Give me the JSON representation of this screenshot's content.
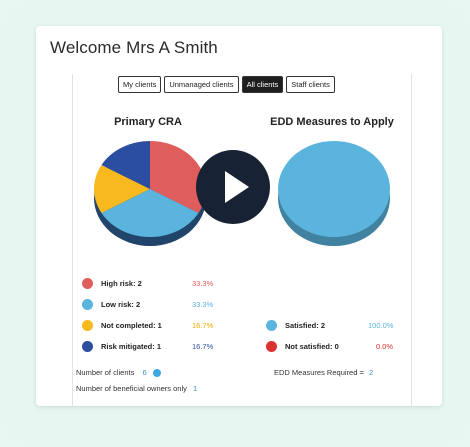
{
  "header": {
    "welcome": "Welcome Mrs A Smith"
  },
  "tabs": [
    {
      "label": "My clients"
    },
    {
      "label": "Unmanaged clients"
    },
    {
      "label": "All clients",
      "active": true
    },
    {
      "label": "Staff clients"
    }
  ],
  "primary_cra": {
    "title": "Primary CRA",
    "legend": [
      {
        "label": "High risk: 2",
        "pct": "33.3%",
        "color": "#e05d5d"
      },
      {
        "label": "Low risk: 2",
        "pct": "33.3%",
        "color": "#5ab4de"
      },
      {
        "label": "Not completed: 1",
        "pct": "16.7%",
        "color": "#f8b91e"
      },
      {
        "label": "Risk mitigated: 1",
        "pct": "16.7%",
        "color": "#2b4ea0"
      }
    ]
  },
  "edd": {
    "title": "EDD Measures to Apply",
    "legend": [
      {
        "label": "Satisfied: 2",
        "pct": "100.0%",
        "color": "#5ab4de"
      },
      {
        "label": "Not satisfied: 0",
        "pct": "0.0%",
        "color": "#d9322f"
      }
    ]
  },
  "footer": {
    "clients_label": "Number of clients",
    "clients_value": "6",
    "beneficial_label": "Number of beneficial owners only",
    "beneficial_value": "1",
    "edd_required_label": "EDD Measures Required =",
    "edd_required_value": "2"
  },
  "chart_data": [
    {
      "type": "pie",
      "title": "Primary CRA",
      "categories": [
        "High risk",
        "Low risk",
        "Not completed",
        "Risk mitigated"
      ],
      "values": [
        2,
        2,
        1,
        1
      ],
      "percentages": [
        33.3,
        33.3,
        16.7,
        16.7
      ]
    },
    {
      "type": "pie",
      "title": "EDD Measures to Apply",
      "categories": [
        "Satisfied",
        "Not satisfied"
      ],
      "values": [
        2,
        0
      ],
      "percentages": [
        100.0,
        0.0
      ]
    }
  ],
  "video": {
    "play_icon": "play-icon"
  }
}
